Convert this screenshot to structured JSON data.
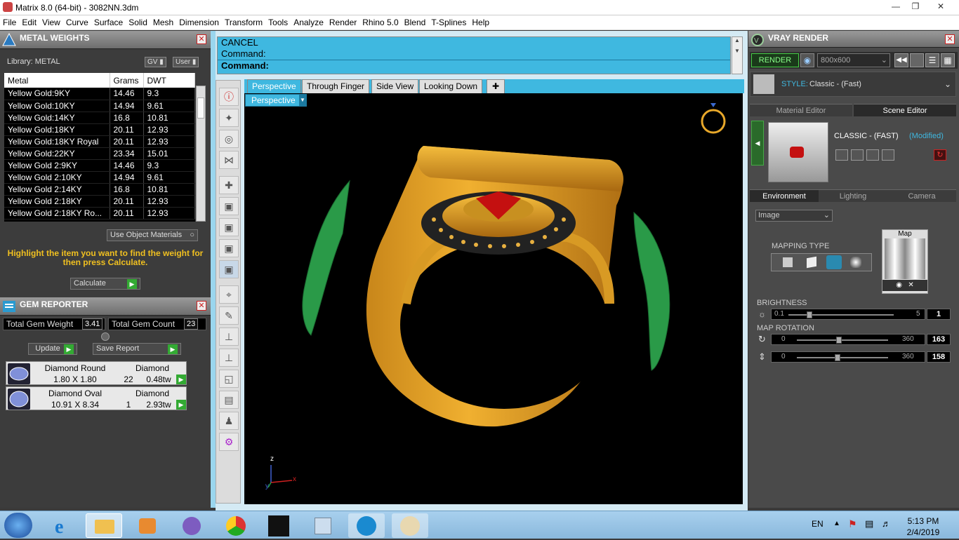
{
  "window": {
    "title": "Matrix 8.0 (64-bit) - 3082NN.3dm"
  },
  "menu": [
    "File",
    "Edit",
    "View",
    "Curve",
    "Surface",
    "Solid",
    "Mesh",
    "Dimension",
    "Transform",
    "Tools",
    "Analyze",
    "Render",
    "Rhino 5.0",
    "Blend",
    "T-Splines",
    "Help"
  ],
  "metal_weights": {
    "title": "METAL WEIGHTS",
    "library_label": "Library: METAL",
    "toggle_gv": "GV",
    "toggle_user": "User",
    "headers": [
      "Metal",
      "Grams",
      "DWT"
    ],
    "rows": [
      [
        "Yellow Gold:9KY",
        "14.46",
        "9.3"
      ],
      [
        "Yellow Gold:10KY",
        "14.94",
        "9.61"
      ],
      [
        "Yellow Gold:14KY",
        "16.8",
        "10.81"
      ],
      [
        "Yellow Gold:18KY",
        "20.11",
        "12.93"
      ],
      [
        "Yellow Gold:18KY Royal",
        "20.11",
        "12.93"
      ],
      [
        "Yellow Gold:22KY",
        "23.34",
        "15.01"
      ],
      [
        "Yellow Gold 2:9KY",
        "14.46",
        "9.3"
      ],
      [
        "Yellow Gold 2:10KY",
        "14.94",
        "9.61"
      ],
      [
        "Yellow Gold 2:14KY",
        "16.8",
        "10.81"
      ],
      [
        "Yellow Gold 2:18KY",
        "20.11",
        "12.93"
      ],
      [
        "Yellow Gold 2:18KY Ro...",
        "20.11",
        "12.93"
      ]
    ],
    "use_object_materials": "Use Object Materials",
    "hint": "Highlight the item you want to find the weight for then press Calculate.",
    "calculate": "Calculate"
  },
  "gem_reporter": {
    "title": "GEM REPORTER",
    "total_weight_label": "Total Gem Weight",
    "total_weight": "3.41",
    "total_count_label": "Total Gem Count",
    "total_count": "23",
    "update": "Update",
    "save_report": "Save Report",
    "gems": [
      {
        "name": "Diamond Round",
        "material": "Diamond",
        "size": "1.80 X 1.80",
        "count": "22",
        "weight": "0.48tw"
      },
      {
        "name": "Diamond Oval",
        "material": "Diamond",
        "size": "10.91 X 8.34",
        "count": "1",
        "weight": "2.93tw"
      }
    ]
  },
  "command": {
    "line1": "CANCEL",
    "line2": "Command:",
    "prompt": "Command:"
  },
  "viewport": {
    "tabs": [
      "Perspective",
      "Through Finger",
      "Side View",
      "Looking Down"
    ],
    "active_tab": "Perspective",
    "view_label": "Perspective",
    "axis_z": "z",
    "axis_x": "x",
    "axis_y": "y"
  },
  "vray": {
    "title": "VRAY RENDER",
    "render_button": "RENDER",
    "resolution": "800x600",
    "style_label": "STYLE:",
    "style_value": "Classic - (Fast)",
    "tabs_top": [
      "Material Editor",
      "Scene Editor"
    ],
    "preset_name": "CLASSIC - (FAST)",
    "preset_state": "(Modified)",
    "tabs_env": [
      "Environment",
      "Lighting",
      "Camera"
    ],
    "env_type": "Image",
    "mapping_type_label": "MAPPING TYPE",
    "map_label": "Map",
    "brightness_label": "BRIGHTNESS",
    "brightness_min": "0.1",
    "brightness_max": "5",
    "brightness_value": "1",
    "map_rotation_label": "MAP ROTATION",
    "rotation1_min": "0",
    "rotation1_max": "360",
    "rotation1_value": "163",
    "rotation2_min": "0",
    "rotation2_max": "360",
    "rotation2_value": "158"
  },
  "taskbar": {
    "lang": "EN",
    "time": "5:13 PM",
    "date": "2/4/2019"
  },
  "colors": {
    "cyan": "#3fb8e0",
    "gold": "#e8a82a",
    "green_prong": "#2a9a48",
    "ruby": "#c41010"
  }
}
